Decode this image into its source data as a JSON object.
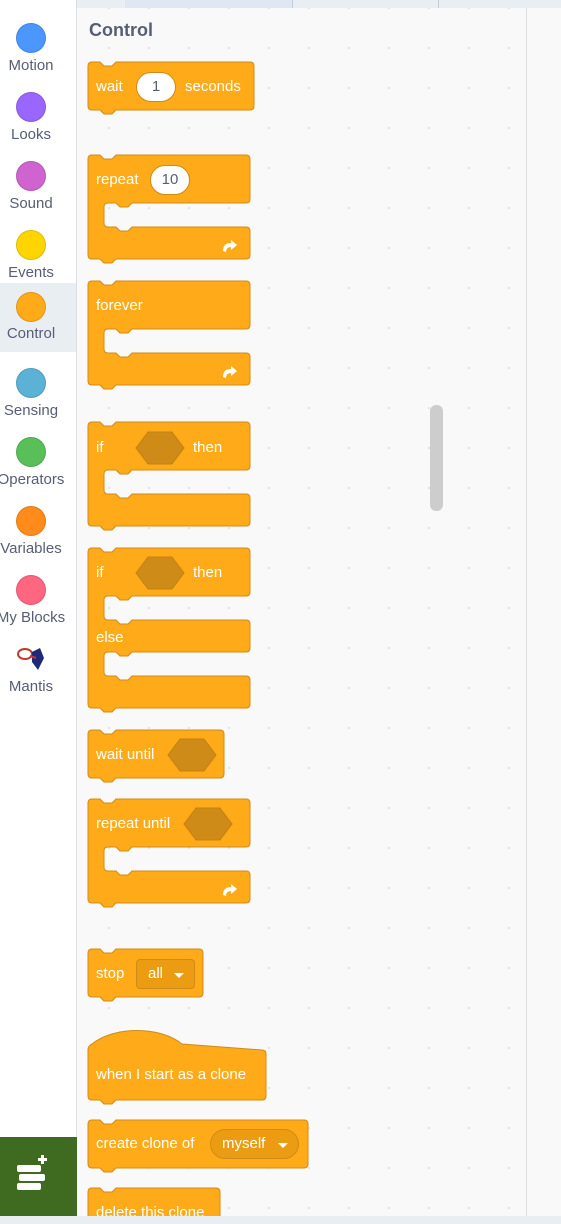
{
  "categories": [
    {
      "label": "Motion",
      "color": "#4c97ff",
      "icon": "motion-dot-icon"
    },
    {
      "label": "Looks",
      "color": "#9966ff",
      "icon": "looks-dot-icon"
    },
    {
      "label": "Sound",
      "color": "#cf63cf",
      "icon": "sound-dot-icon"
    },
    {
      "label": "Events",
      "color": "#ffd500",
      "icon": "events-dot-icon"
    },
    {
      "label": "Control",
      "color": "#ffab19",
      "icon": "control-dot-icon",
      "selected": true
    },
    {
      "label": "Sensing",
      "color": "#5cb1d6",
      "icon": "sensing-dot-icon"
    },
    {
      "label": "Operators",
      "color": "#59c059",
      "icon": "operators-dot-icon"
    },
    {
      "label": "Variables",
      "color": "#ff8c1a",
      "icon": "variables-dot-icon"
    },
    {
      "label": "My Blocks",
      "color": "#ff6680",
      "icon": "my-blocks-dot-icon"
    },
    {
      "label": "Mantis",
      "color": "#ffffff",
      "icon": "mantis-extension-icon"
    }
  ],
  "flyout": {
    "title": "Control",
    "block_color": "#ffab19",
    "blocks": {
      "wait": {
        "label": "wait",
        "value": "1",
        "suffix": "seconds"
      },
      "repeat": {
        "label": "repeat",
        "value": "10"
      },
      "forever": {
        "label": "forever"
      },
      "if_then": {
        "if": "if",
        "then": "then"
      },
      "if_else": {
        "if": "if",
        "then": "then",
        "else": "else"
      },
      "wait_until": {
        "label": "wait until"
      },
      "repeat_until": {
        "label": "repeat until"
      },
      "stop": {
        "label": "stop",
        "option": "all"
      },
      "clone_start": {
        "label": "when I start as a clone"
      },
      "create_clone": {
        "label": "create clone of",
        "option": "myself"
      },
      "delete_clone": {
        "label": "delete this clone"
      }
    }
  },
  "extension_button": {
    "icon": "add-extension-icon"
  }
}
